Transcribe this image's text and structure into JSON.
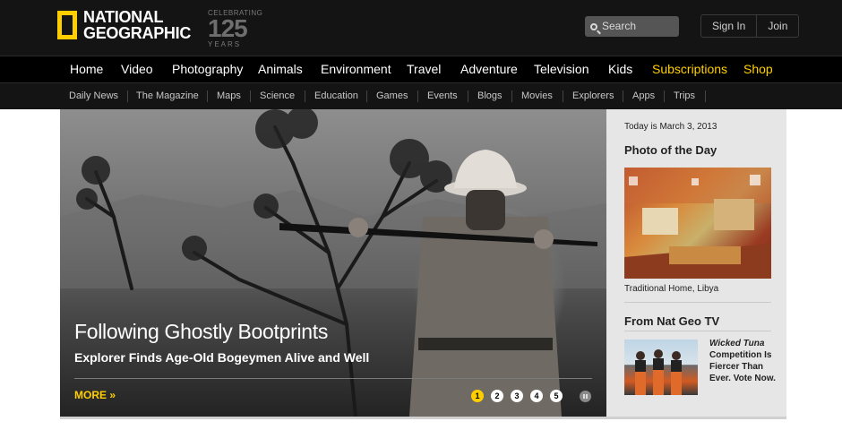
{
  "header": {
    "logo_line1": "NATIONAL",
    "logo_line2": "GEOGRAPHIC",
    "celebrating_label": "CELEBRATING",
    "celebrating_number": "125",
    "celebrating_unit": "YEARS",
    "search_placeholder": "Search",
    "sign_in": "Sign In",
    "join": "Join"
  },
  "main_nav": {
    "items": [
      "Home",
      "Video",
      "Photography",
      "Animals",
      "Environment",
      "Travel",
      "Adventure",
      "Television",
      "Kids",
      "Subscriptions",
      "Shop"
    ],
    "highlight_color": "#ffce00"
  },
  "sub_nav": {
    "items": [
      "Daily News",
      "The Magazine",
      "Maps",
      "Science",
      "Education",
      "Games",
      "Events",
      "Blogs",
      "Movies",
      "Explorers",
      "Apps",
      "Trips"
    ]
  },
  "hero": {
    "title": "Following Ghostly Bootprints",
    "subtitle": "Explorer Finds Age-Old Bogeymen Alive and Well",
    "more_link": "MORE »",
    "slides": [
      "1",
      "2",
      "3",
      "4",
      "5"
    ],
    "active_slide": 1
  },
  "sidebar": {
    "today": "Today is March 3, 2013",
    "photo_of_day_title": "Photo of the Day",
    "photo_caption": "Traditional Home, Libya",
    "tv_title": "From Nat Geo TV",
    "tv_show": "Wicked Tuna",
    "tv_description": "Competition Is Fiercer Than Ever. Vote Now."
  }
}
